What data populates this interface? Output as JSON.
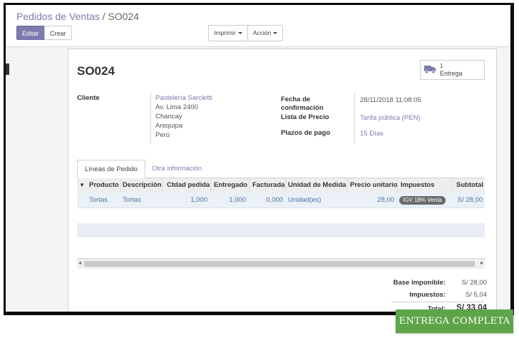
{
  "breadcrumb": {
    "parent": "Pedidos de Ventas",
    "separator": "/",
    "current": "SO024"
  },
  "buttons": {
    "edit": "Editar",
    "create": "Crear",
    "print": "Imprimir",
    "action": "Acción"
  },
  "order": {
    "name": "SO024"
  },
  "smart_button": {
    "count": "1",
    "label": "Entrega",
    "icon": "truck-icon"
  },
  "fields": {
    "customer_label": "Cliente",
    "customer_name": "Pastelería Sarcletti",
    "address_lines": [
      "Av. Lima 2400",
      "Chancay",
      "Arequipa",
      "Perú"
    ],
    "date_label_1": "Fecha de",
    "date_label_2": "confirmación",
    "date_value": "28/11/2018 11:08:05",
    "pricelist_label": "Lista de Precio",
    "pricelist_value": "Tarifa pública (PEN)",
    "payment_label": "Plazos de pago",
    "payment_value": "15 Días"
  },
  "tabs": [
    {
      "label": "Líneas de Pedido"
    },
    {
      "label": "Otra información"
    }
  ],
  "table": {
    "headers": [
      "Producto",
      "Descripción",
      "Ctdad pedida",
      "Entregado",
      "Facturada",
      "Unidad de Medida",
      "Precio unitario",
      "Impuestos",
      "Subtotal"
    ],
    "rows": [
      {
        "product": "Tortas",
        "description": "Tortas",
        "qty": "1,000",
        "delivered": "1,000",
        "invoiced": "0,000",
        "uom": "Unidad(es)",
        "price": "28,00",
        "tax": "IGV 18% Venta",
        "subtotal": "S/ 28,00"
      }
    ]
  },
  "totals": {
    "base_label": "Base imponible:",
    "base_value": "S/ 28,00",
    "tax_label": "Impuestos:",
    "tax_value": "S/ 5,04",
    "total_label": "Total:",
    "total_value": "S/ 33,04"
  },
  "banner": {
    "text": "ENTREGA COMPLETA"
  },
  "colors": {
    "primary": "#7c7bad",
    "banner": "#5ea448",
    "tax_badge": "#6b6b6b"
  }
}
